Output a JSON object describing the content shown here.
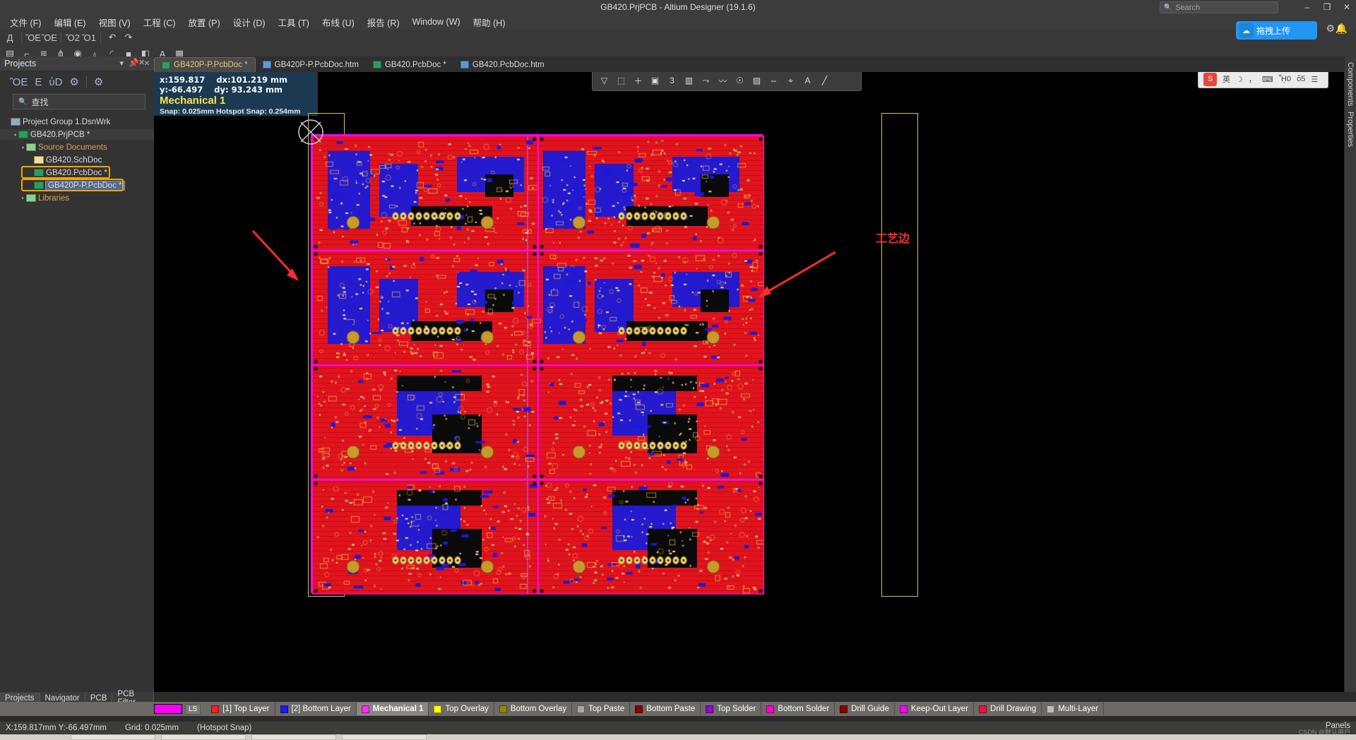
{
  "window": {
    "title": "GB420.PrjPCB - Altium Designer (19.1.6)",
    "minimize": "–",
    "maximize": "❐",
    "close": "✕"
  },
  "search": {
    "placeholder": "Search",
    "icon": "search-icon"
  },
  "topright": {
    "upload_label": "拖拽上传",
    "cloud_icon": "cloud-icon",
    "gear_icon": "gear-icon",
    "bell_icon": "bell-icon",
    "accent": "#2196f3"
  },
  "menubar": [
    {
      "label": "文件 (F)"
    },
    {
      "label": "编辑 (E)"
    },
    {
      "label": "视图 (V)"
    },
    {
      "label": "工程 (C)"
    },
    {
      "label": "放置 (P)"
    },
    {
      "label": "设计 (D)"
    },
    {
      "label": "工具 (T)"
    },
    {
      "label": "布线 (U)"
    },
    {
      "label": "报告 (R)"
    },
    {
      "label": "Window (W)"
    },
    {
      "label": "帮助 (H)"
    }
  ],
  "toolbar_row1": [
    {
      "icon": "altium-logo-icon",
      "glyph": "Д"
    },
    {
      "icon": "save-icon",
      "glyph": "ὋE"
    },
    {
      "icon": "save-all-icon",
      "glyph": "ὋE"
    },
    {
      "icon": "open-folder-icon",
      "glyph": "Ὄ2"
    },
    {
      "icon": "open-project-icon",
      "glyph": "Ὄ1"
    },
    {
      "icon": "undo-icon",
      "glyph": "↶"
    },
    {
      "icon": "redo-icon",
      "glyph": "↷"
    }
  ],
  "toolbar_row2": [
    {
      "icon": "place-polygon-icon",
      "glyph": "▤"
    },
    {
      "icon": "interactive-route-icon",
      "glyph": "⌐"
    },
    {
      "icon": "differential-pair-route-icon",
      "glyph": "≋"
    },
    {
      "icon": "multi-route-icon",
      "glyph": "⋔"
    },
    {
      "icon": "place-pad-icon",
      "glyph": "◉"
    },
    {
      "icon": "place-via-icon",
      "glyph": "♁"
    },
    {
      "icon": "place-arc-icon",
      "glyph": "◜"
    },
    {
      "icon": "place-fill-icon",
      "glyph": "■"
    },
    {
      "icon": "place-region-icon",
      "glyph": "◧"
    },
    {
      "icon": "place-string-icon",
      "glyph": "A"
    },
    {
      "icon": "place-component-icon",
      "glyph": "▦"
    }
  ],
  "projects_panel": {
    "title": "Projects",
    "menu_icon": "chevron-down-icon",
    "pin_icon": "pin-icon",
    "close_icon": "close-icon",
    "tools": [
      {
        "icon": "save-icon",
        "glyph": "ὋE"
      },
      {
        "icon": "compile-icon",
        "glyph": "὜E"
      },
      {
        "icon": "open-project-search-icon",
        "glyph": "ὐD"
      },
      {
        "icon": "project-options-icon",
        "glyph": "⚙"
      },
      {
        "icon": "settings-gear-icon",
        "glyph": "⚙"
      }
    ],
    "search": {
      "placeholder": "查找",
      "icon": "search-icon"
    },
    "tree": [
      {
        "label": "Project Group 1.DsnWrk",
        "indent": 0,
        "icon": "workspace-icon",
        "arrow": "",
        "state": "normal"
      },
      {
        "label": "GB420.PrjPCB *",
        "indent": 1,
        "icon": "project-icon",
        "arrow": "▴",
        "state": "hover"
      },
      {
        "label": "Source Documents",
        "indent": 2,
        "icon": "folder-icon",
        "arrow": "▴",
        "state": "normal"
      },
      {
        "label": "GB420.SchDoc",
        "indent": 3,
        "icon": "schematic-icon",
        "arrow": "",
        "state": "normal"
      },
      {
        "label": "GB420.PcbDoc *",
        "indent": 3,
        "icon": "pcb-icon",
        "arrow": "",
        "state": "highlight"
      },
      {
        "label": "GB420P-P.PcbDoc *",
        "indent": 3,
        "icon": "pcb-icon",
        "arrow": "",
        "state": "selected-highlight"
      },
      {
        "label": "Libraries",
        "indent": 2,
        "icon": "folder-icon",
        "arrow": "▸",
        "state": "normal"
      }
    ],
    "bottom_tabs": [
      {
        "label": "Projects",
        "active": true
      },
      {
        "label": "Navigator",
        "active": false
      },
      {
        "label": "PCB",
        "active": false
      },
      {
        "label": "PCB Filter",
        "active": false
      }
    ]
  },
  "right_dock": [
    {
      "label": "Components"
    },
    {
      "label": "Properties"
    }
  ],
  "document_tabs": [
    {
      "label": "GB420P-P.PcbDoc *",
      "icon": "pcbdoc-icon",
      "active": true
    },
    {
      "label": "GB420P-P.PcbDoc.htm",
      "icon": "htm-icon",
      "active": false
    },
    {
      "label": "GB420.PcbDoc *",
      "icon": "pcbdoc-icon",
      "active": false
    },
    {
      "label": "GB420.PcbDoc.htm",
      "icon": "htm-icon",
      "active": false
    }
  ],
  "coord_overlay": {
    "x_label": "x:159.817",
    "dx_label": "dx:101.219  mm",
    "y_label": "y:-66.497",
    "dy_label": "dy: 93.243  mm",
    "active_layer": "Mechanical 1",
    "snap": "Snap: 0.025mm Hotspot Snap: 0.254mm",
    "layer_color": "#ffe14d",
    "bg": "#1b3a52"
  },
  "mini_toolbar": [
    {
      "icon": "filter-icon",
      "glyph": "▽"
    },
    {
      "icon": "mask-level-icon",
      "glyph": "⬚"
    },
    {
      "icon": "add-icon",
      "glyph": "＋"
    },
    {
      "icon": "board-planning-icon",
      "glyph": "▣"
    },
    {
      "icon": "layer-stack-icon",
      "glyph": "὜3"
    },
    {
      "icon": "board-region-icon",
      "glyph": "▥"
    },
    {
      "icon": "route-icon",
      "glyph": "⤳"
    },
    {
      "icon": "tune-icon",
      "glyph": "〰"
    },
    {
      "icon": "via-stitch-icon",
      "glyph": "☉"
    },
    {
      "icon": "polygon-pour-icon",
      "glyph": "▨"
    },
    {
      "icon": "dimension-icon",
      "glyph": "⇔"
    },
    {
      "icon": "measure-icon",
      "glyph": "⌖"
    },
    {
      "icon": "text-icon",
      "glyph": "A"
    },
    {
      "icon": "line-icon",
      "glyph": "╱"
    }
  ],
  "ime_bar": {
    "logo": "sogou-icon",
    "logo_text": "S",
    "items": [
      {
        "icon": "language-icon",
        "glyph": "英"
      },
      {
        "icon": "moon-icon",
        "glyph": "☽"
      },
      {
        "icon": "punctuation-icon",
        "glyph": "，"
      },
      {
        "icon": "keyboard-icon",
        "glyph": "⌨"
      },
      {
        "icon": "toolbox-icon",
        "glyph": "ᾟ0"
      },
      {
        "icon": "skin-icon",
        "glyph": "ὅ5"
      },
      {
        "icon": "menu-icon",
        "glyph": "☰"
      }
    ]
  },
  "canvas_annotations": [
    {
      "label": "工艺边",
      "color": "#ff2d2d"
    }
  ],
  "layer_bar": {
    "ls_button": "LS",
    "mag_swatch": "#ff00ff",
    "layers": [
      {
        "label": "[1] Top Layer",
        "color": "#ee2222",
        "active": false
      },
      {
        "label": "[2] Bottom Layer",
        "color": "#1a1af0",
        "active": false
      },
      {
        "label": "Mechanical 1",
        "color": "#ff2bff",
        "active": true
      },
      {
        "label": "Top Overlay",
        "color": "#ffff00",
        "active": false
      },
      {
        "label": "Bottom Overlay",
        "color": "#8a8a00",
        "active": false
      },
      {
        "label": "Top Paste",
        "color": "#a8a8a8",
        "active": false
      },
      {
        "label": "Bottom Paste",
        "color": "#8b0000",
        "active": false
      },
      {
        "label": "Top Solder",
        "color": "#9400d3",
        "active": false
      },
      {
        "label": "Bottom Solder",
        "color": "#ff00cc",
        "active": false
      },
      {
        "label": "Drill Guide",
        "color": "#8b0000",
        "active": false
      },
      {
        "label": "Keep-Out Layer",
        "color": "#ff00ff",
        "active": false
      },
      {
        "label": "Drill Drawing",
        "color": "#ee1144",
        "active": false
      },
      {
        "label": "Multi-Layer",
        "color": "#bdbdbd",
        "active": false
      }
    ]
  },
  "status_bar": {
    "coords": "X:159.817mm Y:-66.497mm",
    "grid": "Grid: 0.025mm",
    "snap_mode": "(Hotspot Snap)",
    "panels_button": "Panels"
  },
  "watermark": "CSDN @默认用户"
}
